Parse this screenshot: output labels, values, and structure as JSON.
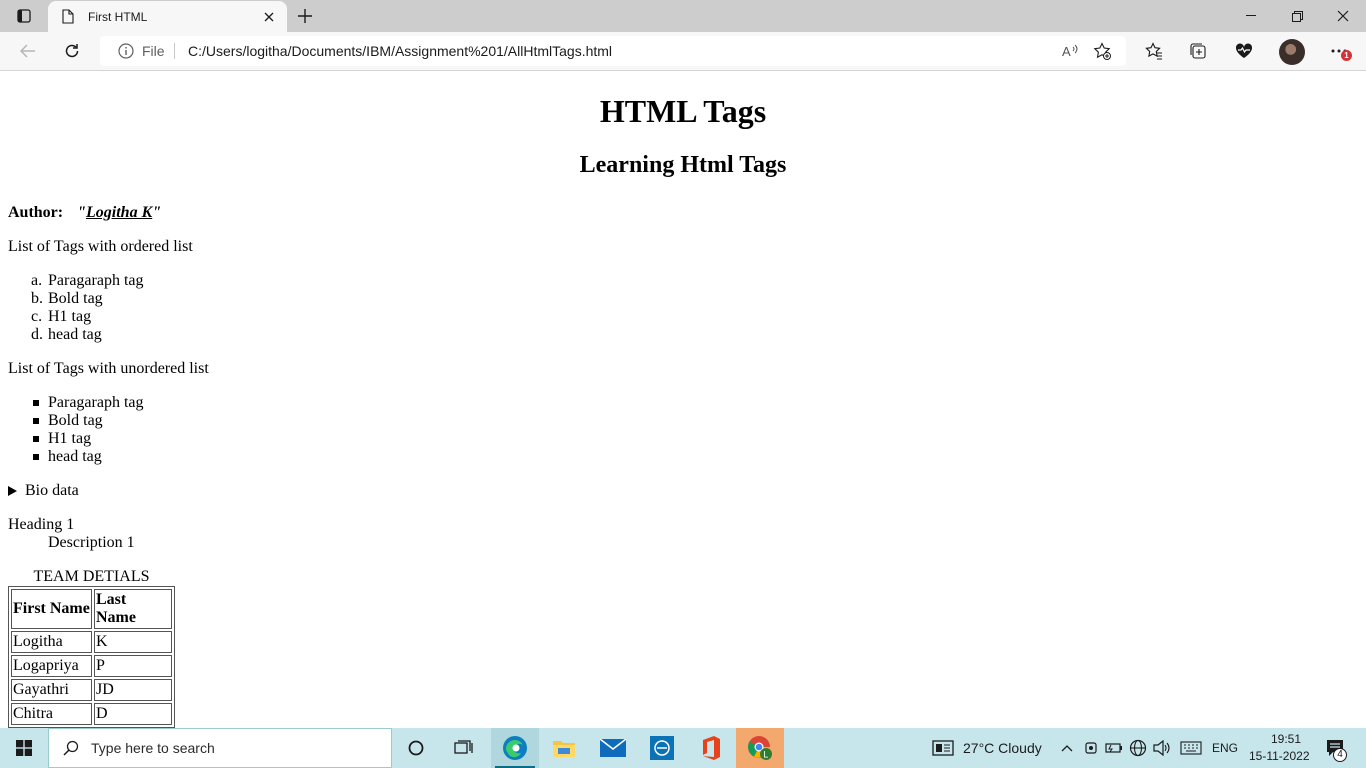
{
  "browser": {
    "tab_title": "First HTML",
    "address_label": "File",
    "url": "C:/Users/logitha/Documents/IBM/Assignment%201/AllHtmlTags.html",
    "read_aloud_label": "Aʾ",
    "notification_count": "1"
  },
  "page": {
    "heading1": "HTML Tags",
    "heading2": "Learning Html Tags",
    "author_label": "Author:",
    "author_quote_open": "\"",
    "author_name": "Logitha K",
    "author_quote_close": "\"",
    "ordered_intro": "List of Tags with ordered list",
    "ordered_items": [
      {
        "marker": "a.",
        "text": "Paragaraph tag"
      },
      {
        "marker": "b.",
        "text": "Bold tag"
      },
      {
        "marker": "c.",
        "text": "H1 tag"
      },
      {
        "marker": "d.",
        "text": "head tag"
      }
    ],
    "unordered_intro": "List of Tags with unordered list",
    "unordered_items": [
      "Paragaraph tag",
      "Bold tag",
      "H1 tag",
      "head tag"
    ],
    "details_summary": "Bio data",
    "dl_term": "Heading 1",
    "dl_description": "Description 1",
    "table_caption": "TEAM DETIALS",
    "table_headers": [
      "First Name",
      "Last Name"
    ],
    "table_rows": [
      [
        "Logitha",
        "K"
      ],
      [
        "Logapriya",
        "P"
      ],
      [
        "Gayathri",
        "JD"
      ],
      [
        "Chitra",
        "D"
      ]
    ]
  },
  "taskbar": {
    "search_placeholder": "Type here to search",
    "weather": "27°C  Cloudy",
    "language": "ENG",
    "time": "19:51",
    "date": "15-11-2022",
    "notification_count": "4"
  }
}
